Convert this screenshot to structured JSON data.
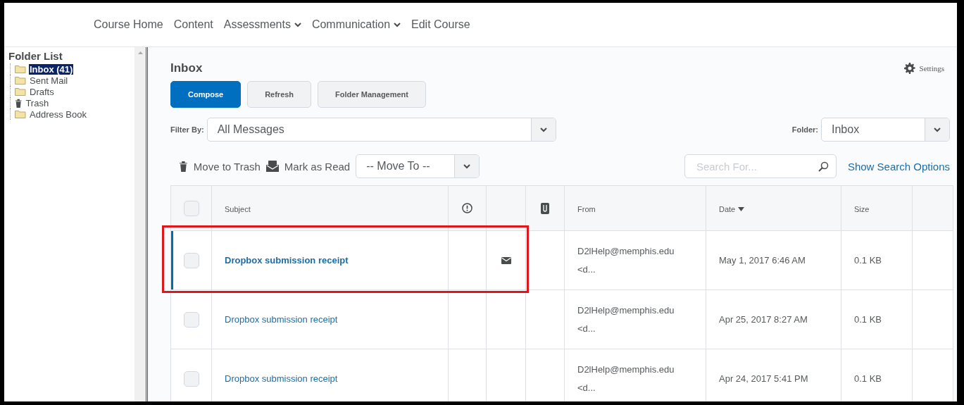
{
  "nav": [
    {
      "label": "Course Home",
      "has_menu": false
    },
    {
      "label": "Content",
      "has_menu": false
    },
    {
      "label": "Assessments",
      "has_menu": true
    },
    {
      "label": "Communication",
      "has_menu": true
    },
    {
      "label": "Edit Course",
      "has_menu": false
    }
  ],
  "sidebar": {
    "title": "Folder List",
    "items": [
      {
        "label": "Inbox (41)",
        "kind": "folder",
        "selected": true
      },
      {
        "label": "Sent Mail",
        "kind": "folder",
        "selected": false
      },
      {
        "label": "Drafts",
        "kind": "folder",
        "selected": false
      },
      {
        "label": "Trash",
        "kind": "trash",
        "selected": false
      },
      {
        "label": "Address Book",
        "kind": "folder",
        "selected": false
      }
    ]
  },
  "title": "Inbox",
  "settings": "Settings",
  "buttons": [
    {
      "label": "Compose",
      "kind": "primary"
    },
    {
      "label": "Refresh",
      "kind": "secondary"
    },
    {
      "label": "Folder Management",
      "kind": "secondary"
    }
  ],
  "filter": {
    "label": "Filter By:",
    "value": "All Messages"
  },
  "folder": {
    "label": "Folder:",
    "value": "Inbox"
  },
  "actions": [
    {
      "label": "Move to Trash",
      "kind": "trash"
    },
    {
      "label": "Mark as Read",
      "kind": "read"
    }
  ],
  "move_to": {
    "value": "-- Move To --"
  },
  "search": {
    "placeholder": "Search For..."
  },
  "search_options": "Show Search Options",
  "columns": [
    {
      "kind": "check",
      "checked": false
    },
    {
      "kind": "text",
      "label": "Subject"
    },
    {
      "kind": "priority"
    },
    {
      "kind": "blank"
    },
    {
      "kind": "attachment"
    },
    {
      "kind": "text",
      "label": "From"
    },
    {
      "kind": "text",
      "label": "Date",
      "sorted": true
    },
    {
      "kind": "text",
      "label": "Size"
    },
    {
      "kind": "blank"
    }
  ],
  "rows": [
    {
      "subject": "Dropbox submission receipt",
      "from": "D2lHelp@memphis.edu <d...",
      "date": "May 1, 2017 6:46 AM",
      "size": "0.1 KB",
      "unread": true,
      "highlighted": true,
      "checked": false
    },
    {
      "subject": "Dropbox submission receipt",
      "from": "D2lHelp@memphis.edu <d...",
      "date": "Apr 25, 2017 8:27 AM",
      "size": "0.1 KB",
      "unread": false,
      "highlighted": false,
      "checked": false
    },
    {
      "subject": "Dropbox submission receipt",
      "from": "D2lHelp@memphis.edu <d...",
      "date": "Apr 24, 2017 5:41 PM",
      "size": "0.1 KB",
      "unread": false,
      "highlighted": false,
      "checked": false
    }
  ]
}
